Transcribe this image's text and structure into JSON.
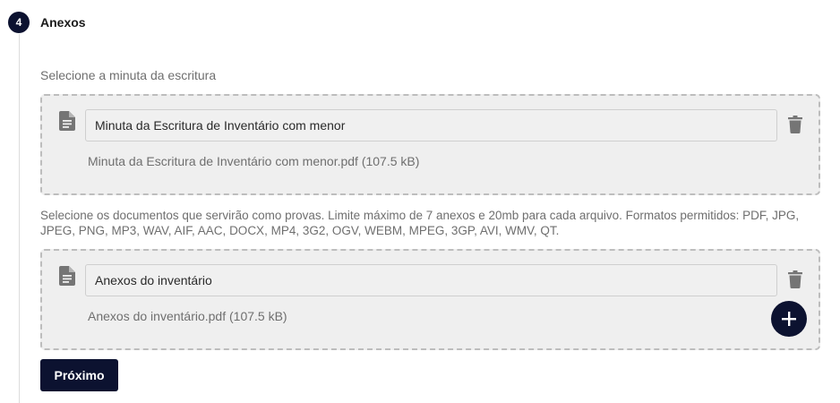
{
  "step": {
    "number": "4",
    "title": "Anexos"
  },
  "minuta": {
    "label": "Selecione a minuta da escritura",
    "file_icon": "document-icon",
    "input_value": "Minuta da Escritura de Inventário com menor",
    "file_info": "Minuta da Escritura de Inventário com menor.pdf (107.5 kB)",
    "delete_icon": "trash-icon"
  },
  "provas": {
    "label": "Selecione os documentos que servirão como provas. Limite máximo de 7 anexos e 20mb para cada arquivo. Formatos permitidos: PDF, JPG, JPEG, PNG, MP3, WAV, AIF, AAC, DOCX, MP4, 3G2, OGV, WEBM, MPEG, 3GP, AVI, WMV, QT.",
    "file_icon": "document-icon",
    "input_value": "Anexos do inventário",
    "file_info": "Anexos do inventário.pdf (107.5 kB)",
    "delete_icon": "trash-icon",
    "add_icon": "plus-icon"
  },
  "actions": {
    "next_label": "Próximo"
  },
  "colors": {
    "primary": "#0c1230",
    "dropzone_bg": "#efefef",
    "muted_text": "#6f6f6f"
  }
}
